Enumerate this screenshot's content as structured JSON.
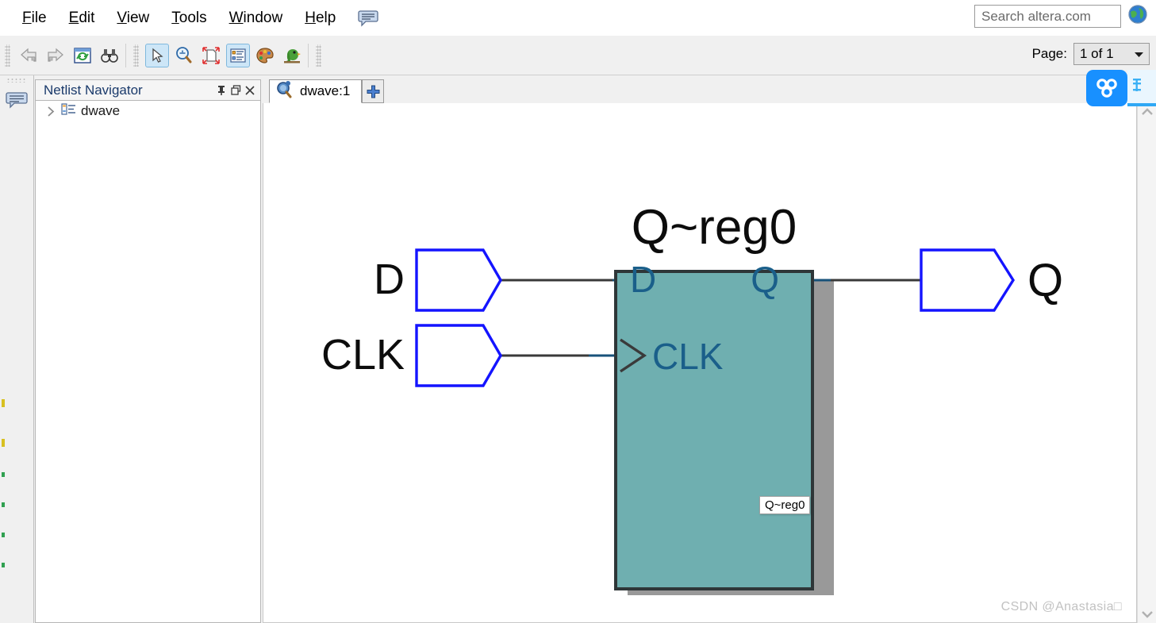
{
  "menu": {
    "items": [
      {
        "name": "file",
        "label": "File",
        "mnemonic": "F"
      },
      {
        "name": "edit",
        "label": "Edit",
        "mnemonic": "E"
      },
      {
        "name": "view",
        "label": "View",
        "mnemonic": "V"
      },
      {
        "name": "tools",
        "label": "Tools",
        "mnemonic": "T"
      },
      {
        "name": "window",
        "label": "Window",
        "mnemonic": "W"
      },
      {
        "name": "help",
        "label": "Help",
        "mnemonic": "H"
      }
    ],
    "bubble_icon": "speech-bubble-icon"
  },
  "search": {
    "placeholder": "Search altera.com",
    "value": "",
    "globe_icon": "globe-icon"
  },
  "toolbar": {
    "buttons": [
      {
        "name": "back-button",
        "icon": "back-arrow-icon",
        "selected": false
      },
      {
        "name": "forward-button",
        "icon": "forward-arrow-icon",
        "selected": false
      },
      {
        "name": "refresh-button",
        "icon": "refresh-icon",
        "selected": false
      },
      {
        "name": "find-button",
        "icon": "binoculars-icon",
        "selected": false
      },
      {
        "name": "select-tool",
        "icon": "cursor-arrow-icon",
        "selected": true
      },
      {
        "name": "zoom-tool",
        "icon": "zoom-magnifier-icon",
        "selected": false
      },
      {
        "name": "fit-page-tool",
        "icon": "fit-page-icon",
        "selected": false
      },
      {
        "name": "properties-tool",
        "icon": "properties-list-icon",
        "selected": true
      },
      {
        "name": "color-tool",
        "icon": "palette-icon",
        "selected": false
      },
      {
        "name": "bird-tool",
        "icon": "parrot-icon",
        "selected": false
      }
    ],
    "page_label": "Page:",
    "page_value": "1 of 1",
    "page_caret": "chevron-down-icon"
  },
  "netlist_navigator": {
    "title": "Netlist Navigator",
    "window_buttons": [
      {
        "name": "pin-button",
        "glyph": "⇱"
      },
      {
        "name": "restore-button",
        "glyph": "❐"
      },
      {
        "name": "close-button",
        "glyph": "✕"
      }
    ],
    "tree": [
      {
        "name": "tree-item-dwave",
        "label": "dwave",
        "chevron": "chevron-right-icon",
        "icon": "hierarchy-icon",
        "expanded": false
      }
    ]
  },
  "editor": {
    "tab": {
      "label": "dwave:1",
      "icon": "schematic-viewer-icon"
    },
    "add_tab_icon": "plus-icon"
  },
  "schematic": {
    "block_title": "Q~reg0",
    "tooltip": "Q~reg0",
    "block_fill": "#6FAFB0",
    "block_border": "#323a3c",
    "block_shadow": "#999999",
    "pin_outline": "#1414ff",
    "wire_color": "#3a3a3a",
    "port_label_color": "#1a5f8a",
    "inputs": [
      {
        "name": "pin-d",
        "outer_label": "D",
        "port_label": "D",
        "clocked": false
      },
      {
        "name": "pin-clk",
        "outer_label": "CLK",
        "port_label": "CLK",
        "clocked": true
      }
    ],
    "outputs": [
      {
        "name": "pin-q",
        "outer_label": "Q",
        "port_label": "Q"
      }
    ]
  },
  "scrollbar": {
    "up_arrow": "chevron-up-icon",
    "down_arrow": "chevron-down-icon"
  },
  "floating_widget": {
    "name": "cloud-assistant-widget",
    "icon": "three-circles-icon",
    "color": "#1890ff"
  },
  "watermark": "CSDN @Anastasia□"
}
